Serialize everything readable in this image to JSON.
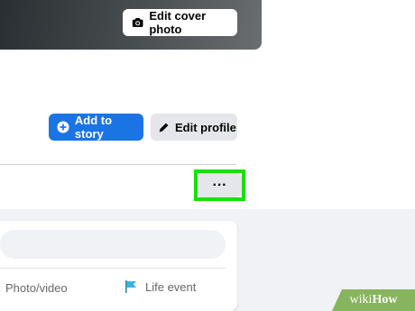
{
  "cover": {
    "edit_cover_label": "Edit cover photo",
    "icon": "camera-icon"
  },
  "profile_actions": {
    "add_to_story_label": "Add to story",
    "add_to_story_icon": "plus-circle-icon",
    "edit_profile_label": "Edit profile",
    "edit_profile_icon": "pencil-icon"
  },
  "more_button": {
    "label": "···",
    "icon": "more-options-icon",
    "highlight_color": "#19e000"
  },
  "composer": {
    "photo_video_label": "Photo/video",
    "life_event_label": "Life event",
    "life_event_icon": "flag-icon"
  },
  "watermark": {
    "prefix": "wiki",
    "suffix": "How"
  },
  "colors": {
    "accent": "#1b74e4",
    "button_gray": "#e4e6eb",
    "feed_bg": "#f0f2f5",
    "watermark_green": "#87b45e"
  }
}
